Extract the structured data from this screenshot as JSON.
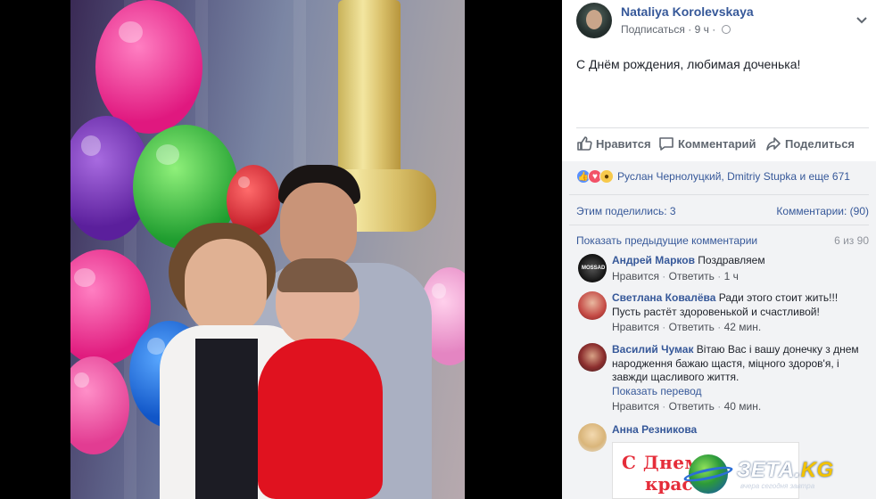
{
  "post": {
    "author": "Nataliya Korolevskaya",
    "follow": "Подписаться",
    "time": "9 ч",
    "separator": "·",
    "text": "С Днём рождения, любимая доченька!"
  },
  "actions": {
    "like": "Нравится",
    "comment": "Комментарий",
    "share": "Поделиться"
  },
  "reactions": {
    "summary": "Руслан Чернолуцкий, Dmitriy Stupka и еще 671",
    "icons": [
      "like-icon",
      "love-icon",
      "wow-icon"
    ],
    "colors": {
      "like": "#5890ff",
      "love": "#f25268",
      "wow": "#f7c94b"
    }
  },
  "stats": {
    "shares": "Этим поделились: 3",
    "comments": "Комментарии: (90)"
  },
  "comments_nav": {
    "previous": "Показать предыдущие комментарии",
    "count": "6 из 90"
  },
  "comments": [
    {
      "name": "Андрей Марков",
      "text": "Поздравляем",
      "like": "Нравится",
      "reply": "Ответить",
      "time": "1 ч"
    },
    {
      "name": "Светлана Ковалёва",
      "text": "Ради этого стоит жить!!! Пусть растёт здоровенькой и счастливой!",
      "like": "Нравится",
      "reply": "Ответить",
      "time": "42 мин."
    },
    {
      "name": "Василий Чумак",
      "text": "Вітаю Вас і вашу донечку з днем народження бажаю щастя, міцного здоров'я, і завжди щасливого життя.",
      "translate": "Показать перевод",
      "like": "Нравится",
      "reply": "Ответить",
      "time": "40 мин."
    },
    {
      "name": "Анна Резникова"
    }
  ],
  "sticker": {
    "line1": "С Днем",
    "line2": "крас"
  },
  "watermark": {
    "logo_main": "ЗЕТА.",
    "logo_accent": "KG",
    "tagline": "вчера сегодня завтра"
  },
  "colors": {
    "link": "#365899",
    "text": "#1d2129",
    "muted": "#90949c",
    "panel_bg": "#ffffff",
    "gray_bg": "#f2f3f5"
  }
}
